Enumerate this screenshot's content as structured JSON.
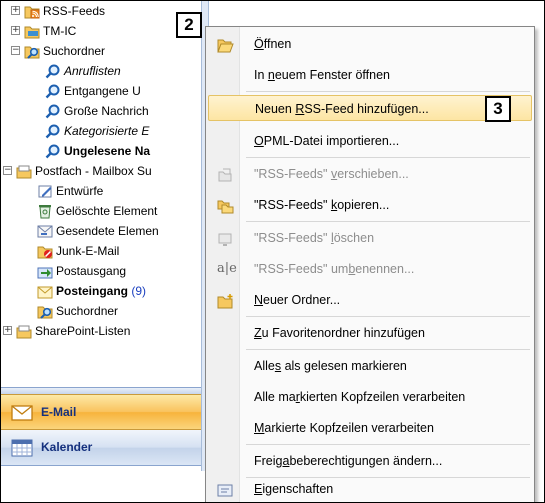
{
  "tree": {
    "items": [
      {
        "label": "RSS-Feeds",
        "expander": "+",
        "icon": "rss-folder-icon",
        "style": "normal"
      },
      {
        "label": "TM-IC",
        "expander": "+",
        "icon": "folder-icon",
        "style": "normal"
      },
      {
        "label": "Suchordner",
        "expander": "−",
        "icon": "search-folder-icon",
        "style": "normal"
      },
      {
        "label": "Anruflisten",
        "expander": "",
        "icon": "search-folder-icon",
        "style": "italic"
      },
      {
        "label": "Entgangene U",
        "expander": "",
        "icon": "search-folder-icon",
        "style": "normal"
      },
      {
        "label": "Große Nachrich",
        "expander": "",
        "icon": "search-folder-icon",
        "style": "normal"
      },
      {
        "label": "Kategorisierte E",
        "expander": "",
        "icon": "search-folder-icon",
        "style": "italic"
      },
      {
        "label": "Ungelesene Na",
        "expander": "",
        "icon": "search-folder-icon",
        "style": "bold"
      },
      {
        "label": "Postfach - Mailbox Su",
        "expander": "−",
        "icon": "mailbox-icon",
        "style": "normal"
      },
      {
        "label": "Entwürfe",
        "expander": "",
        "icon": "drafts-icon",
        "style": "normal"
      },
      {
        "label": "Gelöschte Element",
        "expander": "",
        "icon": "deleted-items-icon",
        "style": "normal"
      },
      {
        "label": "Gesendete Elemen",
        "expander": "",
        "icon": "sent-items-icon",
        "style": "normal"
      },
      {
        "label": "Junk-E-Mail",
        "expander": "",
        "icon": "junk-mail-icon",
        "style": "normal"
      },
      {
        "label": "Postausgang",
        "expander": "",
        "icon": "outbox-icon",
        "style": "normal"
      },
      {
        "label": "Posteingang",
        "expander": "",
        "icon": "inbox-icon",
        "style": "bold",
        "count": "(9)"
      },
      {
        "label": "Suchordner",
        "expander": "",
        "icon": "search-folder-icon",
        "style": "normal"
      },
      {
        "label": "SharePoint-Listen",
        "expander": "+",
        "icon": "sharepoint-folder-icon",
        "style": "normal"
      }
    ]
  },
  "nav": {
    "mail": "E-Mail",
    "calendar": "Kalender"
  },
  "annotations": {
    "a2": "2",
    "a3": "3"
  },
  "menu": {
    "items": [
      {
        "pre": "",
        "u": "Ö",
        "post": "ffnen",
        "icon": "open-folder-icon",
        "disabled": false
      },
      {
        "pre": "In ",
        "u": "n",
        "post": "euem Fenster öffnen",
        "icon": "",
        "disabled": false
      },
      {
        "pre": "Neuen ",
        "u": "R",
        "post": "SS-Feed hinzufügen...",
        "icon": "",
        "disabled": false,
        "highlighted": true
      },
      {
        "pre": "",
        "u": "O",
        "post": "PML-Datei importieren...",
        "icon": "",
        "disabled": false
      },
      {
        "pre": "\"RSS-Feeds\" ",
        "u": "v",
        "post": "erschieben...",
        "icon": "move-folder-icon",
        "disabled": true
      },
      {
        "pre": "\"RSS-Feeds\" ",
        "u": "k",
        "post": "opieren...",
        "icon": "copy-folder-icon",
        "disabled": false
      },
      {
        "pre": "\"RSS-Feeds\" ",
        "u": "l",
        "post": "öschen",
        "icon": "delete-icon",
        "disabled": true
      },
      {
        "pre": "\"RSS-Feeds\" um",
        "u": "b",
        "post": "enennen...",
        "icon": "rename-icon",
        "disabled": true
      },
      {
        "pre": "",
        "u": "N",
        "post": "euer Ordner...",
        "icon": "new-folder-icon",
        "disabled": false
      },
      {
        "pre": "",
        "u": "Z",
        "post": "u Favoritenordner hinzufügen",
        "icon": "",
        "disabled": false
      },
      {
        "pre": "Alle",
        "u": "s",
        "post": " als gelesen markieren",
        "icon": "",
        "disabled": false
      },
      {
        "pre": "Alle ma",
        "u": "r",
        "post": "kierten Kopfzeilen verarbeiten",
        "icon": "",
        "disabled": false
      },
      {
        "pre": "",
        "u": "M",
        "post": "arkierte Kopfzeilen verarbeiten",
        "icon": "",
        "disabled": false
      },
      {
        "pre": "Freig",
        "u": "a",
        "post": "beberechtigungen ändern...",
        "icon": "",
        "disabled": false
      },
      {
        "pre": "",
        "u": "E",
        "post": "igenschaften",
        "icon": "properties-icon",
        "disabled": false
      }
    ]
  }
}
